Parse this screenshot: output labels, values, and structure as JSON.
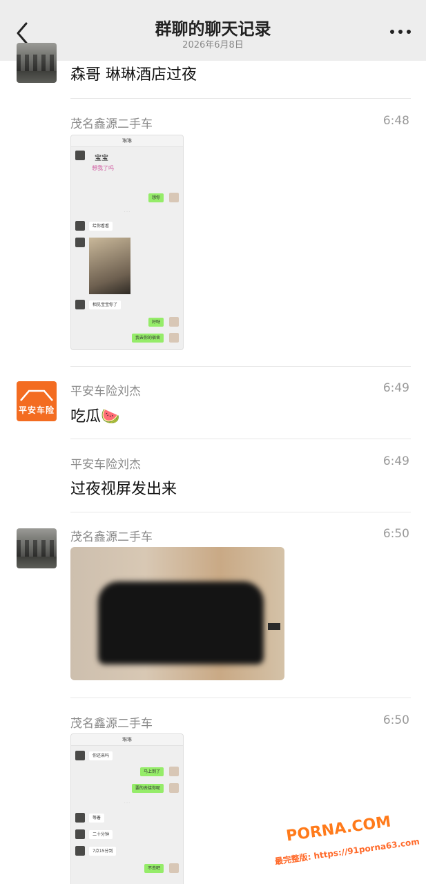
{
  "header": {
    "title": "群聊的聊天记录",
    "date": "2026年6月8日",
    "back_icon": "chevron-left-icon",
    "more_icon": "more-dots-icon"
  },
  "messages": [
    {
      "sender": "",
      "time": "",
      "text": "森哥 琳琳酒店过夜"
    },
    {
      "sender": "茂名鑫源二手车",
      "time": "6:48",
      "screenshot": {
        "chat_title": "琳琳",
        "sticker_line1": "宝宝",
        "sticker_line2": "想我了吗",
        "bubble_1": "想你",
        "bubble_2": "给你看看",
        "bubble_3": "相见宝宝你了",
        "bubble_4": "好呀",
        "bubble_5": "我去你的宿舍"
      }
    },
    {
      "sender": "平安车险刘杰",
      "time": "6:49",
      "text": "吃瓜🍉",
      "avatar_label": "平安车险"
    },
    {
      "sender": "平安车险刘杰",
      "time": "6:49",
      "text": "过夜视屏发出来"
    },
    {
      "sender": "茂名鑫源二手车",
      "time": "6:50",
      "image": "photo"
    },
    {
      "sender": "茂名鑫源二手车",
      "time": "6:50",
      "screenshot": {
        "chat_title": "琳琳",
        "bubble_1": "你还来吗",
        "bubble_2": "马上到了",
        "bubble_3": "要的去接你呢",
        "bubble_4": "等着",
        "bubble_5": "二十分钟",
        "bubble_6": "7点15分到",
        "bubble_7": "不去吧"
      }
    }
  ],
  "watermark": {
    "brand": "PORNA.COM",
    "url_line": "最完整版: https://91porna63.com"
  },
  "colors": {
    "header_bg": "#ededed",
    "pingan_orange": "#f36c21",
    "wechat_green_bubble": "#95ec69"
  }
}
